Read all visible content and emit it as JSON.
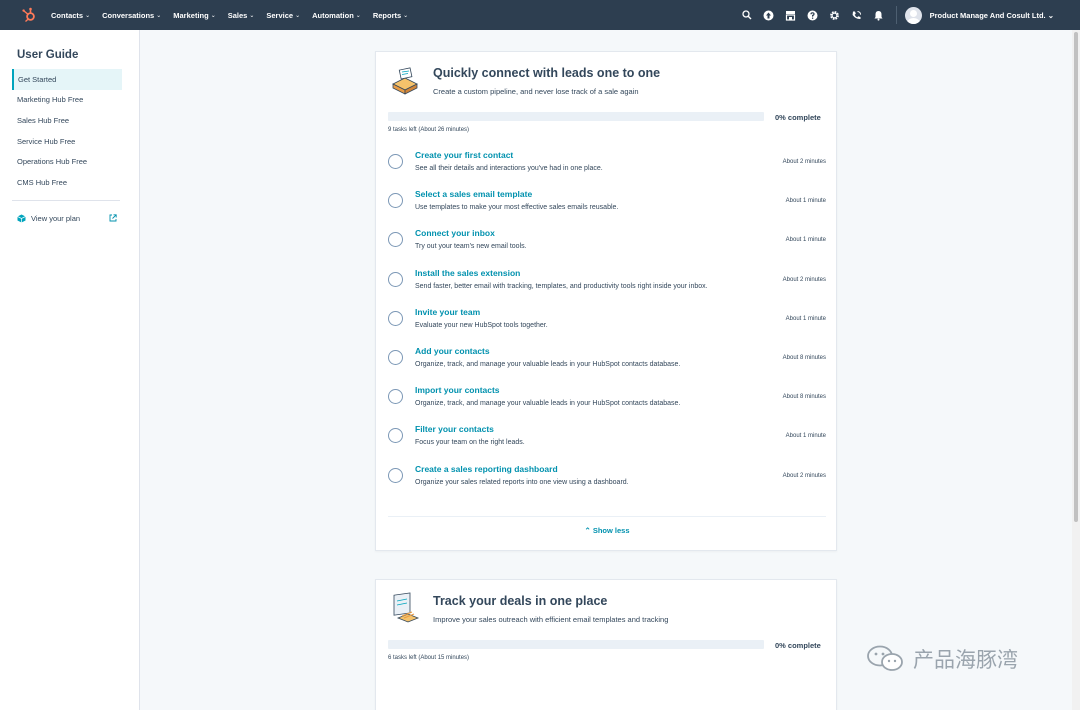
{
  "nav": {
    "items": [
      {
        "label": "Contacts"
      },
      {
        "label": "Conversations"
      },
      {
        "label": "Marketing"
      },
      {
        "label": "Sales"
      },
      {
        "label": "Service"
      },
      {
        "label": "Automation"
      },
      {
        "label": "Reports"
      }
    ],
    "account_name": "Product Manage And Cosult Ltd.",
    "icons": [
      "search-icon",
      "upgrade-icon",
      "marketplace-icon",
      "help-icon",
      "settings-icon",
      "calling-icon",
      "notifications-icon"
    ]
  },
  "sidebar": {
    "title": "User Guide",
    "items": [
      {
        "label": "Get Started",
        "active": true
      },
      {
        "label": "Marketing Hub Free"
      },
      {
        "label": "Sales Hub Free"
      },
      {
        "label": "Service Hub Free"
      },
      {
        "label": "Operations Hub Free"
      },
      {
        "label": "CMS Hub Free"
      }
    ],
    "plan_link": "View your plan"
  },
  "cards": [
    {
      "title": "Quickly connect with leads one to one",
      "subtitle": "Create a custom pipeline, and never lose track of a sale again",
      "progress_percent": 0,
      "progress_label": "0% complete",
      "tasks_left": "9 tasks left  (About 26 minutes)",
      "tasks": [
        {
          "title": "Create your first contact",
          "desc": "See all their details and interactions you've had in one place.",
          "time": "About 2 minutes"
        },
        {
          "title": "Select a sales email template",
          "desc": "Use templates to make your most effective sales emails reusable.",
          "time": "About 1 minute"
        },
        {
          "title": "Connect your inbox",
          "desc": "Try out your team's new email tools.",
          "time": "About 1 minute"
        },
        {
          "title": "Install the sales extension",
          "desc": "Send faster, better email with tracking, templates, and productivity tools right inside your inbox.",
          "time": "About 2 minutes"
        },
        {
          "title": "Invite your team",
          "desc": "Evaluate your new HubSpot tools together.",
          "time": "About 1 minute"
        },
        {
          "title": "Add your contacts",
          "desc": "Organize, track, and manage your valuable leads in your HubSpot contacts database.",
          "time": "About 8 minutes"
        },
        {
          "title": "Import your contacts",
          "desc": "Organize, track, and manage your valuable leads in your HubSpot contacts database.",
          "time": "About 8 minutes"
        },
        {
          "title": "Filter your contacts",
          "desc": "Focus your team on the right leads.",
          "time": "About 1 minute"
        },
        {
          "title": "Create a sales reporting dashboard",
          "desc": "Organize your sales related reports into one view using a dashboard.",
          "time": "About 2 minutes"
        }
      ],
      "show_less": "Show less"
    },
    {
      "title": "Track your deals in one place",
      "subtitle": "Improve your sales outreach with efficient email templates and tracking",
      "progress_percent": 0,
      "progress_label": "0% complete",
      "tasks_left": "6 tasks left  (About 15 minutes)"
    }
  ],
  "watermark": "产品海豚湾",
  "colors": {
    "nav_bg": "#2d3e50",
    "link": "#0091ae",
    "accent": "#00a4bd",
    "logo": "#ff7a59"
  }
}
